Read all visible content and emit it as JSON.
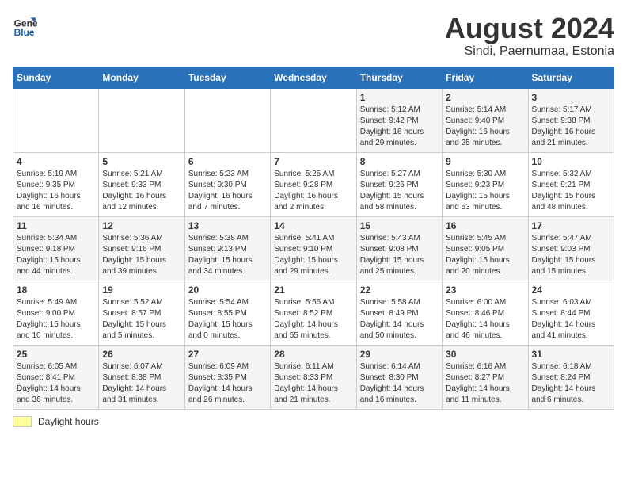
{
  "logo": {
    "line1": "General",
    "line2": "Blue"
  },
  "title": "August 2024",
  "subtitle": "Sindi, Paernumaa, Estonia",
  "days_of_week": [
    "Sunday",
    "Monday",
    "Tuesday",
    "Wednesday",
    "Thursday",
    "Friday",
    "Saturday"
  ],
  "weeks": [
    [
      {
        "day": "",
        "info": ""
      },
      {
        "day": "",
        "info": ""
      },
      {
        "day": "",
        "info": ""
      },
      {
        "day": "",
        "info": ""
      },
      {
        "day": "1",
        "info": "Sunrise: 5:12 AM\nSunset: 9:42 PM\nDaylight: 16 hours\nand 29 minutes."
      },
      {
        "day": "2",
        "info": "Sunrise: 5:14 AM\nSunset: 9:40 PM\nDaylight: 16 hours\nand 25 minutes."
      },
      {
        "day": "3",
        "info": "Sunrise: 5:17 AM\nSunset: 9:38 PM\nDaylight: 16 hours\nand 21 minutes."
      }
    ],
    [
      {
        "day": "4",
        "info": "Sunrise: 5:19 AM\nSunset: 9:35 PM\nDaylight: 16 hours\nand 16 minutes."
      },
      {
        "day": "5",
        "info": "Sunrise: 5:21 AM\nSunset: 9:33 PM\nDaylight: 16 hours\nand 12 minutes."
      },
      {
        "day": "6",
        "info": "Sunrise: 5:23 AM\nSunset: 9:30 PM\nDaylight: 16 hours\nand 7 minutes."
      },
      {
        "day": "7",
        "info": "Sunrise: 5:25 AM\nSunset: 9:28 PM\nDaylight: 16 hours\nand 2 minutes."
      },
      {
        "day": "8",
        "info": "Sunrise: 5:27 AM\nSunset: 9:26 PM\nDaylight: 15 hours\nand 58 minutes."
      },
      {
        "day": "9",
        "info": "Sunrise: 5:30 AM\nSunset: 9:23 PM\nDaylight: 15 hours\nand 53 minutes."
      },
      {
        "day": "10",
        "info": "Sunrise: 5:32 AM\nSunset: 9:21 PM\nDaylight: 15 hours\nand 48 minutes."
      }
    ],
    [
      {
        "day": "11",
        "info": "Sunrise: 5:34 AM\nSunset: 9:18 PM\nDaylight: 15 hours\nand 44 minutes."
      },
      {
        "day": "12",
        "info": "Sunrise: 5:36 AM\nSunset: 9:16 PM\nDaylight: 15 hours\nand 39 minutes."
      },
      {
        "day": "13",
        "info": "Sunrise: 5:38 AM\nSunset: 9:13 PM\nDaylight: 15 hours\nand 34 minutes."
      },
      {
        "day": "14",
        "info": "Sunrise: 5:41 AM\nSunset: 9:10 PM\nDaylight: 15 hours\nand 29 minutes."
      },
      {
        "day": "15",
        "info": "Sunrise: 5:43 AM\nSunset: 9:08 PM\nDaylight: 15 hours\nand 25 minutes."
      },
      {
        "day": "16",
        "info": "Sunrise: 5:45 AM\nSunset: 9:05 PM\nDaylight: 15 hours\nand 20 minutes."
      },
      {
        "day": "17",
        "info": "Sunrise: 5:47 AM\nSunset: 9:03 PM\nDaylight: 15 hours\nand 15 minutes."
      }
    ],
    [
      {
        "day": "18",
        "info": "Sunrise: 5:49 AM\nSunset: 9:00 PM\nDaylight: 15 hours\nand 10 minutes."
      },
      {
        "day": "19",
        "info": "Sunrise: 5:52 AM\nSunset: 8:57 PM\nDaylight: 15 hours\nand 5 minutes."
      },
      {
        "day": "20",
        "info": "Sunrise: 5:54 AM\nSunset: 8:55 PM\nDaylight: 15 hours\nand 0 minutes."
      },
      {
        "day": "21",
        "info": "Sunrise: 5:56 AM\nSunset: 8:52 PM\nDaylight: 14 hours\nand 55 minutes."
      },
      {
        "day": "22",
        "info": "Sunrise: 5:58 AM\nSunset: 8:49 PM\nDaylight: 14 hours\nand 50 minutes."
      },
      {
        "day": "23",
        "info": "Sunrise: 6:00 AM\nSunset: 8:46 PM\nDaylight: 14 hours\nand 46 minutes."
      },
      {
        "day": "24",
        "info": "Sunrise: 6:03 AM\nSunset: 8:44 PM\nDaylight: 14 hours\nand 41 minutes."
      }
    ],
    [
      {
        "day": "25",
        "info": "Sunrise: 6:05 AM\nSunset: 8:41 PM\nDaylight: 14 hours\nand 36 minutes."
      },
      {
        "day": "26",
        "info": "Sunrise: 6:07 AM\nSunset: 8:38 PM\nDaylight: 14 hours\nand 31 minutes."
      },
      {
        "day": "27",
        "info": "Sunrise: 6:09 AM\nSunset: 8:35 PM\nDaylight: 14 hours\nand 26 minutes."
      },
      {
        "day": "28",
        "info": "Sunrise: 6:11 AM\nSunset: 8:33 PM\nDaylight: 14 hours\nand 21 minutes."
      },
      {
        "day": "29",
        "info": "Sunrise: 6:14 AM\nSunset: 8:30 PM\nDaylight: 14 hours\nand 16 minutes."
      },
      {
        "day": "30",
        "info": "Sunrise: 6:16 AM\nSunset: 8:27 PM\nDaylight: 14 hours\nand 11 minutes."
      },
      {
        "day": "31",
        "info": "Sunrise: 6:18 AM\nSunset: 8:24 PM\nDaylight: 14 hours\nand 6 minutes."
      }
    ]
  ],
  "legend": {
    "label": "Daylight hours"
  }
}
